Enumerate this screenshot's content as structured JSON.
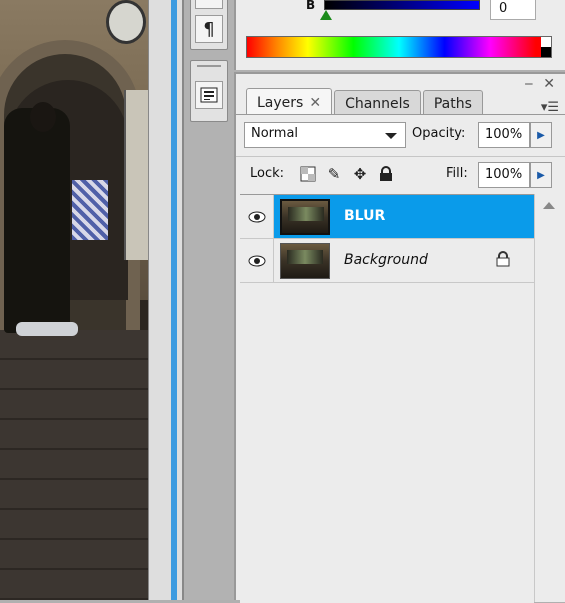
{
  "color_panel": {
    "channel_label": "B",
    "channel_value": "0"
  },
  "dock": {
    "paragraph_icon": "¶",
    "top_icon": "¶"
  },
  "layers_panel": {
    "tabs": [
      {
        "label": "Layers"
      },
      {
        "label": "Channels"
      },
      {
        "label": "Paths"
      }
    ],
    "blend_mode": "Normal",
    "opacity_label": "Opacity:",
    "opacity_value": "100%",
    "lock_label": "Lock:",
    "fill_label": "Fill:",
    "fill_value": "100%",
    "layers": [
      {
        "name": "BLUR",
        "selected": true,
        "locked": false
      },
      {
        "name": "Background",
        "selected": false,
        "locked": true
      }
    ]
  },
  "colors": {
    "selection": "#0a9bea",
    "accent_blue": "#3d9be0"
  }
}
